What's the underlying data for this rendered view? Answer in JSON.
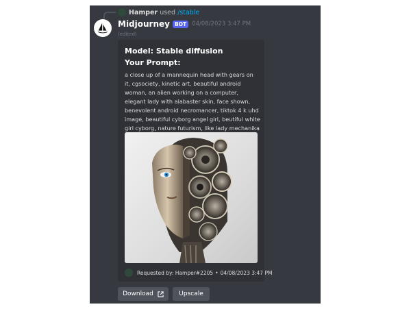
{
  "reply": {
    "username": "Hamper",
    "used": "used",
    "command": "/stable"
  },
  "message": {
    "username": "Midjourney",
    "bot_tag": "BOT",
    "timestamp": "04/08/2023 3:47 PM",
    "edited": "(edited)"
  },
  "embed": {
    "title": "Model: Stable diffusion",
    "prompt_label": "Your Prompt:",
    "description": "a close up of a mannequin head with gears on it, cgsociety, kinetic art, beautiful android woman, an alien working on a computer, elegant lady with alabaster skin, face shown, benevolent android necromancer, tiktok 4 k uhd image, beautiful cyborg angel girl, beutiful white girl cyborg, nature futurism, like lady mechanika",
    "footer_requested": "Requested by: Hamper#2205",
    "footer_sep": "•",
    "footer_time": "04/08/2023 3:47 PM"
  },
  "buttons": {
    "download": "Download",
    "upscale": "Upscale"
  },
  "icons": {
    "external_link": "external-link-icon",
    "avatar": "sailboat-logo"
  },
  "colors": {
    "background": "#36393f",
    "embed": "#2f3136",
    "bot_tag": "#5865f2",
    "command": "#00aff4",
    "button": "#4f545c"
  }
}
